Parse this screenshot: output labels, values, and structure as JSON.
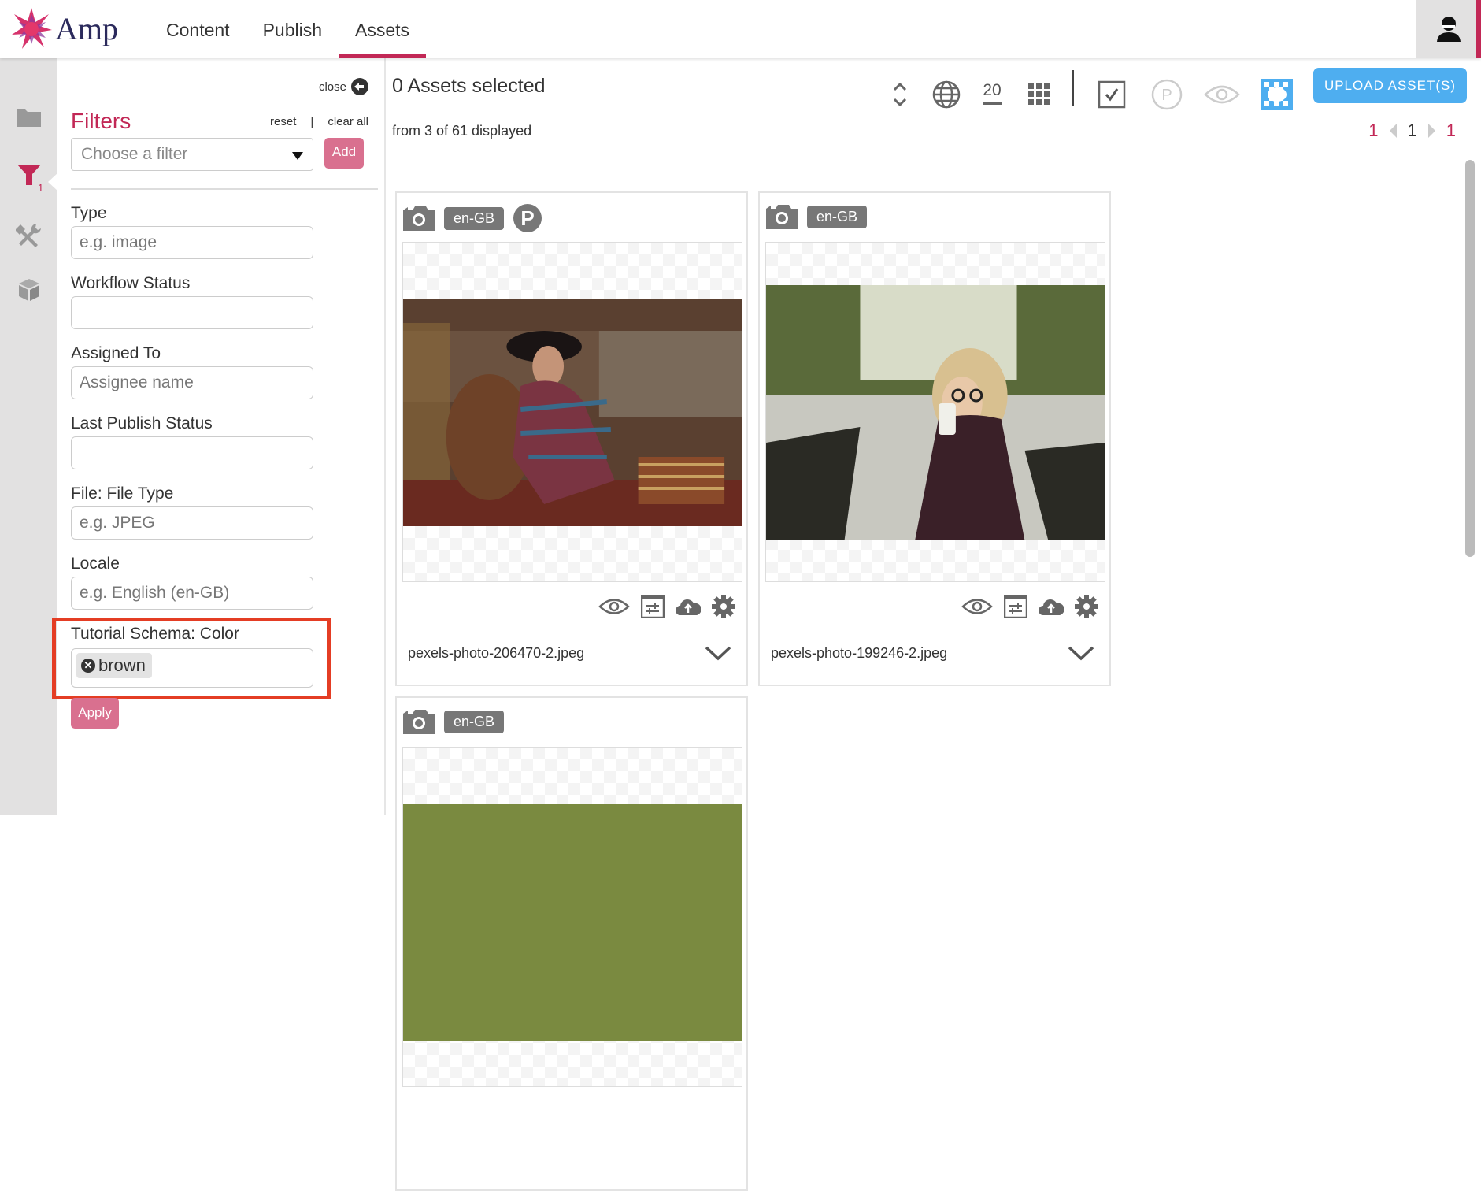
{
  "app": {
    "name": "Amp",
    "brand_color": "#c22856",
    "accent_color": "#4eaef0"
  },
  "nav": {
    "tabs": [
      {
        "label": "Content"
      },
      {
        "label": "Publish"
      },
      {
        "label": "Assets",
        "active": true
      }
    ]
  },
  "user": {
    "icon": "user-icon"
  },
  "rail": {
    "items": [
      {
        "icon": "folder-icon"
      },
      {
        "icon": "filter-icon",
        "badge": "1",
        "active": true
      },
      {
        "icon": "tools-icon"
      },
      {
        "icon": "cube-icon"
      }
    ]
  },
  "filters": {
    "close_label": "close",
    "title": "Filters",
    "reset_label": "reset",
    "separator": "|",
    "clear_all_label": "clear all",
    "choose_placeholder": "Choose a filter",
    "add_label": "Add",
    "fields": [
      {
        "label": "Type",
        "placeholder": "e.g. image",
        "value": ""
      },
      {
        "label": "Workflow Status",
        "placeholder": "",
        "value": ""
      },
      {
        "label": "Assigned To",
        "placeholder": "Assignee name",
        "value": ""
      },
      {
        "label": "Last Publish Status",
        "placeholder": "",
        "value": ""
      },
      {
        "label": "File: File Type",
        "placeholder": "e.g. JPEG",
        "value": ""
      },
      {
        "label": "Locale",
        "placeholder": "e.g. English (en-GB)",
        "value": ""
      }
    ],
    "color_field": {
      "label": "Tutorial Schema: Color",
      "chips": [
        "brown"
      ]
    },
    "apply_label": "Apply"
  },
  "main": {
    "selection_title": "0 Assets selected",
    "selection_sub": "from 3 of 61 displayed",
    "toolbar": {
      "page_size": "20",
      "upload_label": "UPLOAD ASSET(S)"
    },
    "pager": {
      "first": "1",
      "current": "1",
      "last": "1"
    },
    "cards": [
      {
        "type_icon": "camera-icon",
        "locale": "en-GB",
        "published": true,
        "filename": "pexels-photo-206470-2.jpeg"
      },
      {
        "type_icon": "camera-icon",
        "locale": "en-GB",
        "published": false,
        "filename": "pexels-photo-199246-2.jpeg"
      },
      {
        "type_icon": "camera-icon",
        "locale": "en-GB",
        "published": false,
        "filename": ""
      }
    ]
  }
}
